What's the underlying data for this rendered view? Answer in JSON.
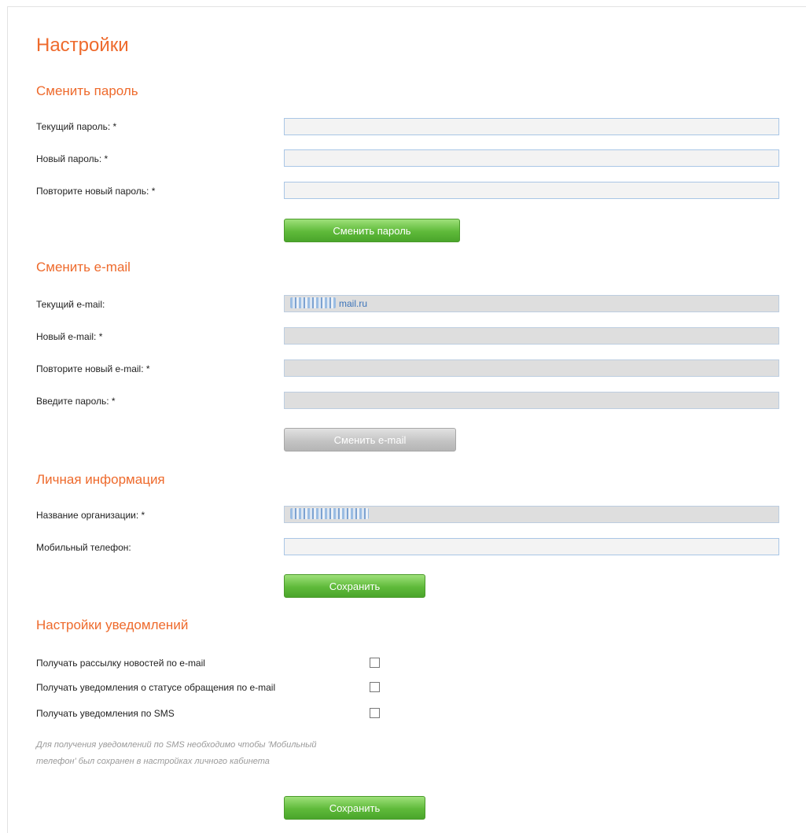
{
  "page": {
    "title": "Настройки"
  },
  "password_section": {
    "title": "Сменить пароль",
    "current_label": "Текущий пароль: *",
    "new_label": "Новый пароль: *",
    "repeat_label": "Повторите новый пароль: *",
    "submit_label": "Сменить пароль"
  },
  "email_section": {
    "title": "Сменить e-mail",
    "current_label": "Текущий e-mail:",
    "current_value_visible": "mail.ru",
    "new_label": "Новый e-mail: *",
    "repeat_label": "Повторите новый e-mail: *",
    "password_label": "Введите пароль: *",
    "submit_label": "Сменить e-mail"
  },
  "personal_section": {
    "title": "Личная информация",
    "org_label": "Название организации: *",
    "phone_label": "Мобильный телефон:",
    "submit_label": "Сохранить"
  },
  "notifications_section": {
    "title": "Настройки уведомлений",
    "options": [
      {
        "label": "Получать рассылку новостей по e-mail",
        "checked": false
      },
      {
        "label": "Получать уведомления о статусе обращения по e-mail",
        "checked": false
      },
      {
        "label": "Получать уведомления по SMS",
        "checked": false
      }
    ],
    "hint": "Для получения уведомлений по SMS необходимо чтобы 'Мобильный телефон' был сохранен в настройках личного кабинета",
    "submit_label": "Сохранить"
  },
  "colors": {
    "accent": "#ee6a2c",
    "button_green": "#5fba3a",
    "button_disabled": "#c4c4c4",
    "field_border": "#a9c6e6"
  }
}
